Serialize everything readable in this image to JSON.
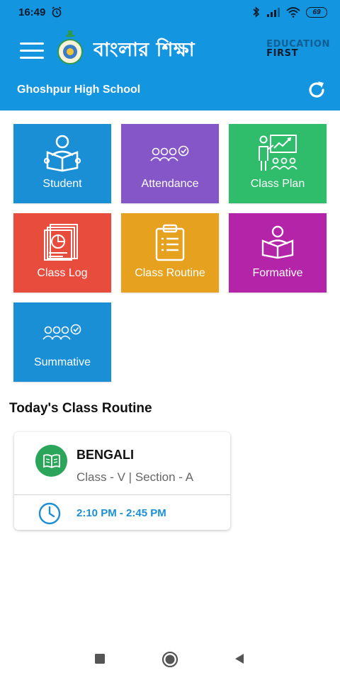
{
  "status_bar": {
    "time": "16:49",
    "battery": "69"
  },
  "app_bar": {
    "title": "বাংলার শিক্ষা",
    "brand_line1": "EDUCATION",
    "brand_line2": "FIRST",
    "school": "Ghoshpur High School"
  },
  "tiles": [
    {
      "label": "Student",
      "color": "#1a8fd6",
      "icon": "student-reading-icon"
    },
    {
      "label": "Attendance",
      "color": "#8456c8",
      "icon": "attendance-group-icon"
    },
    {
      "label": "Class Plan",
      "color": "#2fbd6c",
      "icon": "class-plan-board-icon"
    },
    {
      "label": "Class Log",
      "color": "#e84c3d",
      "icon": "class-log-report-icon"
    },
    {
      "label": "Class Routine",
      "color": "#e6a11f",
      "icon": "clipboard-list-icon"
    },
    {
      "label": "Formative",
      "color": "#b424a8",
      "icon": "formative-reading-icon"
    },
    {
      "label": "Summative",
      "color": "#1a8fd6",
      "icon": "summative-group-icon"
    }
  ],
  "routine": {
    "title": "Today's Class Routine",
    "subject": "BENGALI",
    "class_info": "Class - V | Section - A",
    "time": "2:10 PM - 2:45 PM"
  },
  "colors": {
    "primary": "#1495e0",
    "time_text": "#1a8fd6",
    "book_badge": "#2aa55a"
  }
}
